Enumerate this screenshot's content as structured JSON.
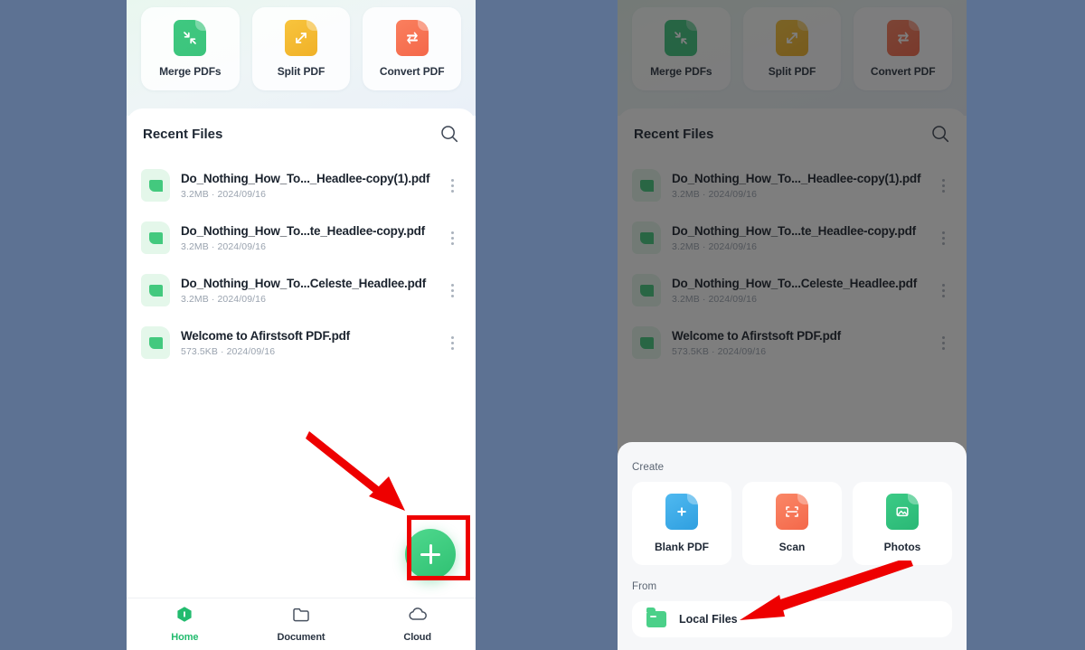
{
  "app": {
    "background_color": "#5d7293",
    "accent_color": "#2fc072"
  },
  "tools": {
    "items": [
      {
        "label": "Merge PDFs",
        "icon": "merge-icon",
        "color": "#3cc47c"
      },
      {
        "label": "Split PDF",
        "icon": "split-icon",
        "color": "#f0b128"
      },
      {
        "label": "Convert PDF",
        "icon": "convert-icon",
        "color": "#f4684a"
      }
    ]
  },
  "recent": {
    "title": "Recent Files",
    "search_icon": "search-icon",
    "files": [
      {
        "name": "Do_Nothing_How_To..._Headlee-copy(1).pdf",
        "size": "3.2MB",
        "date": "2024/09/16",
        "sub": "3.2MB · 2024/09/16"
      },
      {
        "name": "Do_Nothing_How_To...te_Headlee-copy.pdf",
        "size": "3.2MB",
        "date": "2024/09/16",
        "sub": "3.2MB · 2024/09/16"
      },
      {
        "name": "Do_Nothing_How_To...Celeste_Headlee.pdf",
        "size": "3.2MB",
        "date": "2024/09/16",
        "sub": "3.2MB · 2024/09/16"
      },
      {
        "name": "Welcome to Afirstsoft PDF.pdf",
        "size": "573.5KB",
        "date": "2024/09/16",
        "sub": "573.5KB · 2024/09/16"
      }
    ]
  },
  "fab": {
    "icon": "plus-icon",
    "label": "+"
  },
  "tabbar": {
    "items": [
      {
        "label": "Home",
        "icon": "home-icon",
        "active": true
      },
      {
        "label": "Document",
        "icon": "folder-icon",
        "active": false
      },
      {
        "label": "Cloud",
        "icon": "cloud-icon",
        "active": false
      }
    ]
  },
  "sheet": {
    "create_label": "Create",
    "create_items": [
      {
        "label": "Blank PDF",
        "icon": "blank-pdf-icon",
        "color": "#2f9fe0"
      },
      {
        "label": "Scan",
        "icon": "scan-icon",
        "color": "#f4684a"
      },
      {
        "label": "Photos",
        "icon": "photos-icon",
        "color": "#2ab876"
      }
    ],
    "from_label": "From",
    "from_items": [
      {
        "label": "Local Files",
        "icon": "folder-icon"
      }
    ]
  },
  "annotations": {
    "arrow_color": "#ee0000",
    "highlight_color": "#ee0000",
    "arrow_left_target": "fab",
    "arrow_right_target": "local-files-row"
  }
}
